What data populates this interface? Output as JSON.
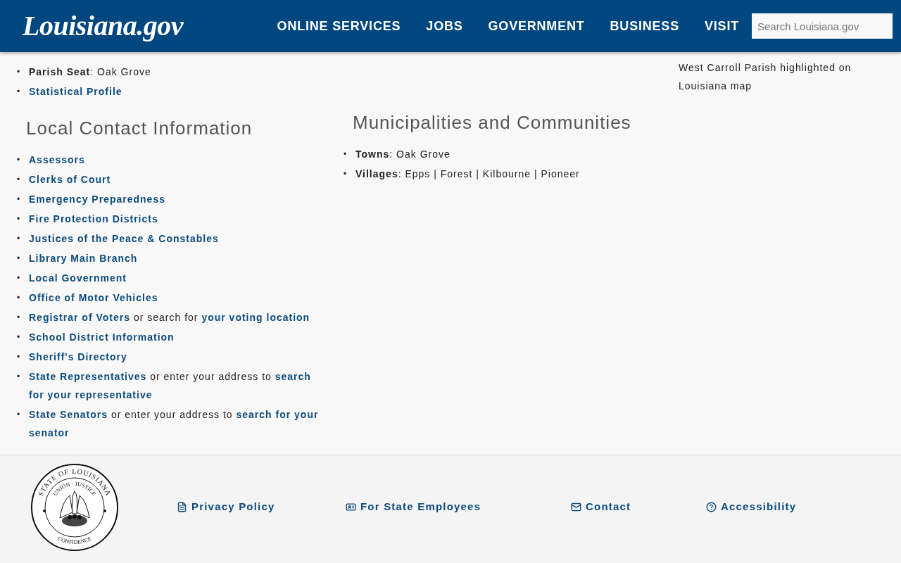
{
  "header": {
    "logo": "Louisiana.gov",
    "nav": [
      "ONLINE SERVICES",
      "JOBS",
      "GOVERNMENT",
      "BUSINESS",
      "VISIT"
    ],
    "search": {
      "placeholder": "Search Louisiana.gov"
    }
  },
  "bullet": "•",
  "parish_info": [
    {
      "kind": "text",
      "text": "**Parish Seat**: Oak Grove"
    },
    {
      "kind": "link",
      "text": "Statistical Profile"
    }
  ],
  "map_caption": "West Carroll Parish highlighted on Louisiana map",
  "local_contact": {
    "heading": "Local Contact Information",
    "items": [
      [
        {
          "text": "Assessors",
          "link": true
        }
      ],
      [
        {
          "text": "Clerks of Court",
          "link": true
        }
      ],
      [
        {
          "text": "Emergency Preparedness",
          "link": true
        }
      ],
      [
        {
          "text": "Fire Protection Districts",
          "link": true
        }
      ],
      [
        {
          "text": "Justices of the Peace & Constables",
          "link": true
        }
      ],
      [
        {
          "text": "Library Main Branch",
          "link": true
        }
      ],
      [
        {
          "text": "Local Government",
          "link": true
        }
      ],
      [
        {
          "text": "Office of Motor Vehicles",
          "link": true
        }
      ],
      [
        {
          "text": "Registrar of Voters",
          "link": true
        },
        {
          "text": "or search for",
          "link": false
        },
        {
          "text": "your voting location",
          "link": true
        }
      ],
      [
        {
          "text": "School District Information",
          "link": true
        }
      ],
      [
        {
          "text": "Sheriff's Directory",
          "link": true
        }
      ],
      [
        {
          "text": "State Representatives",
          "link": true
        },
        {
          "text": "or enter your address to",
          "link": false
        },
        {
          "text": "search",
          "link": true
        },
        {
          "text": "for your representative",
          "link": true
        }
      ],
      [
        {
          "text": "State Senators",
          "link": true
        },
        {
          "text": "or enter your address to",
          "link": false
        },
        {
          "text": "search for your",
          "link": true
        },
        {
          "text": "senator",
          "link": true
        }
      ]
    ]
  },
  "municipalities": {
    "heading": "Municipalities and Communities",
    "items": [
      "**Towns**: Oak Grove",
      "**Villages**: Epps | Forest | Kilbourne | Pioneer"
    ]
  },
  "footer": {
    "seal": {
      "top": "STATE OF LOUISIANA",
      "inner": "UNION · JUSTICE",
      "bottom": "CONFIDENCE"
    },
    "links": [
      {
        "kind": "document",
        "label": "Privacy Policy"
      },
      {
        "kind": "id-card",
        "label": "For State Employees"
      },
      {
        "kind": "mail",
        "label": "Contact"
      },
      {
        "kind": "help",
        "label": "Accessibility"
      }
    ]
  }
}
